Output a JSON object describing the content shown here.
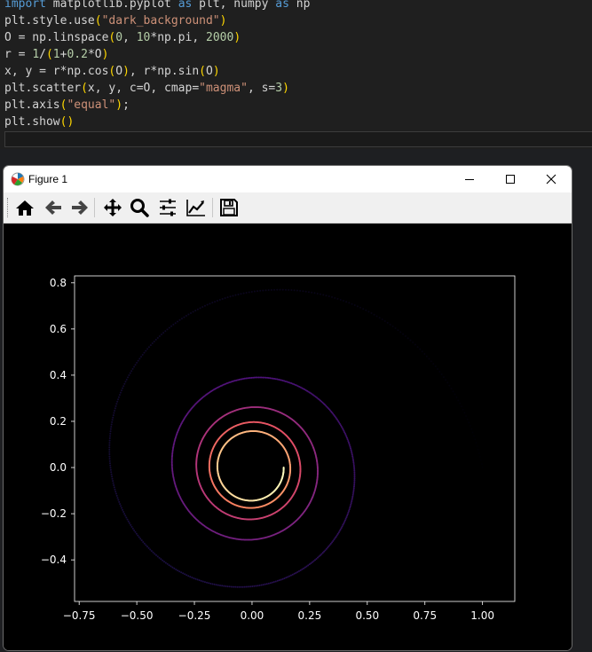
{
  "code_cell": {
    "lines": [
      [
        [
          "kw",
          "import"
        ],
        [
          "t",
          " matplotlib.pyplot "
        ],
        [
          "kw",
          "as"
        ],
        [
          "t",
          " plt, numpy "
        ],
        [
          "kw",
          "as"
        ],
        [
          "t",
          " np"
        ]
      ],
      [
        [
          "t",
          "plt.style.use"
        ],
        [
          "par",
          "("
        ],
        [
          "str",
          "\"dark_background\""
        ],
        [
          "par",
          ")"
        ]
      ],
      [
        [
          "t",
          "O = np.linspace"
        ],
        [
          "par",
          "("
        ],
        [
          "num",
          "0"
        ],
        [
          "t",
          ", "
        ],
        [
          "num",
          "10"
        ],
        [
          "t",
          "*np.pi, "
        ],
        [
          "num",
          "2000"
        ],
        [
          "par",
          ")"
        ]
      ],
      [
        [
          "t",
          "r = "
        ],
        [
          "num",
          "1"
        ],
        [
          "t",
          "/"
        ],
        [
          "par",
          "("
        ],
        [
          "num",
          "1"
        ],
        [
          "t",
          "+"
        ],
        [
          "num",
          "0.2"
        ],
        [
          "t",
          "*O"
        ],
        [
          "par",
          ")"
        ]
      ],
      [
        [
          "t",
          "x, y = r*np.cos"
        ],
        [
          "par",
          "("
        ],
        [
          "t",
          "O"
        ],
        [
          "par",
          ")"
        ],
        [
          "t",
          ", r*np.sin"
        ],
        [
          "par",
          "("
        ],
        [
          "t",
          "O"
        ],
        [
          "par",
          ")"
        ]
      ],
      [
        [
          "t",
          "plt.scatter"
        ],
        [
          "par",
          "("
        ],
        [
          "t",
          "x, y, c=O, cmap="
        ],
        [
          "str",
          "\"magma\""
        ],
        [
          "t",
          ", s="
        ],
        [
          "num",
          "3"
        ],
        [
          "par",
          ")"
        ]
      ],
      [
        [
          "t",
          "plt.axis"
        ],
        [
          "par",
          "("
        ],
        [
          "str",
          "\"equal\""
        ],
        [
          "par",
          ")"
        ],
        [
          "t",
          ";"
        ]
      ],
      [
        [
          "t",
          "plt.show"
        ],
        [
          "par",
          "()"
        ]
      ]
    ]
  },
  "window": {
    "title": "Figure 1",
    "buttons": {
      "minimize": "minimize",
      "maximize": "maximize",
      "close": "close"
    }
  },
  "toolbar": {
    "items": [
      "home-icon",
      "back-icon",
      "forward-icon",
      "pan-icon",
      "zoom-icon",
      "subplots-icon",
      "edit-axes-icon",
      "save-icon"
    ]
  },
  "chart_data": {
    "type": "scatter",
    "description_params": {
      "theta_start": 0,
      "theta_end_pi_multiple": 10,
      "points": 2000,
      "r_formula": "1/(1+0.2*theta)",
      "colormap": "magma",
      "marker_size": 3
    },
    "x_ticks": [
      "−0.75",
      "−0.50",
      "−0.25",
      "0.00",
      "0.25",
      "0.50",
      "0.75",
      "1.00"
    ],
    "x_tick_values": [
      -0.75,
      -0.5,
      -0.25,
      0.0,
      0.25,
      0.5,
      0.75,
      1.0
    ],
    "y_ticks": [
      "0.8",
      "0.6",
      "0.4",
      "0.2",
      "0.0",
      "−0.2",
      "−0.4"
    ],
    "y_tick_values": [
      0.8,
      0.6,
      0.4,
      0.2,
      0.0,
      -0.2,
      -0.4
    ],
    "xlim": [
      -0.77,
      1.14
    ],
    "ylim": [
      -0.58,
      0.83
    ],
    "background": "#000000",
    "axis_color": "#ffffff"
  }
}
